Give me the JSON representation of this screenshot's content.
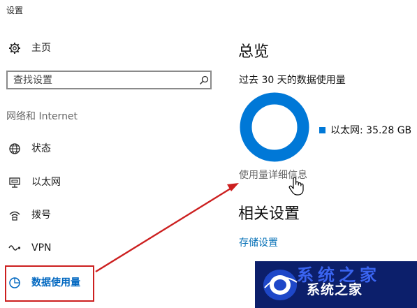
{
  "window": {
    "title": "设置"
  },
  "sidebar": {
    "home_label": "主页",
    "search_placeholder": "查找设置",
    "section_label": "网络和 Internet",
    "items": [
      {
        "label": "状态",
        "icon": "globe-icon"
      },
      {
        "label": "以太网",
        "icon": "ethernet-icon"
      },
      {
        "label": "拨号",
        "icon": "dialup-icon"
      },
      {
        "label": "VPN",
        "icon": "vpn-icon"
      },
      {
        "label": "数据使用量",
        "icon": "data-usage-icon",
        "active": true
      }
    ]
  },
  "main": {
    "overview_title": "总览",
    "period_label": "过去 30 天的数据使用量",
    "legend_label": "以太网: 35.28 GB",
    "donut": {
      "share": 1.0,
      "color": "#0078d7"
    },
    "details_link": "使用量详细信息",
    "related_title": "相关设置",
    "storage_link": "存储设置"
  },
  "watermark": {
    "text": "系统之家",
    "text_top": "系统之家"
  },
  "colors": {
    "accent": "#0078d7",
    "annotation": "#cc1f1f"
  }
}
